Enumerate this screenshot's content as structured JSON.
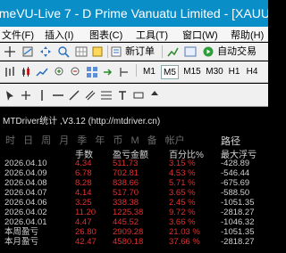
{
  "window": {
    "title": "rimeVU-Live 7 - D Prime Vanuatu Limited - [XAUU..."
  },
  "menu": [
    "文件(F)",
    "插入(I)",
    "图表(C)",
    "工具(T)",
    "窗口(W)",
    "帮助(H)"
  ],
  "toolbar": {
    "new_order": "新订单",
    "auto_trading": "自动交易"
  },
  "timeframes": [
    "M1",
    "M5",
    "M15",
    "M30",
    "H1",
    "H4"
  ],
  "selected_timeframe": "M5",
  "ea": {
    "title": "MTDriver统计 ,V3.12 (http://mtdriver.cn)",
    "period_tabs": [
      "时",
      "日",
      "周",
      "月",
      "季",
      "年",
      "币",
      "M",
      "备",
      "帐户"
    ],
    "path_label": "路径",
    "columns": [
      "手数",
      "盈亏金额",
      "百分比%",
      "最大浮亏"
    ],
    "rows": [
      {
        "date": "2026.04.10",
        "lots": "4.34",
        "pnl": "511.73",
        "pct": "3.15 %",
        "max_dd": "-428.89"
      },
      {
        "date": "2026.04.09",
        "lots": "6.78",
        "pnl": "702.81",
        "pct": "4.53 %",
        "max_dd": "-546.44"
      },
      {
        "date": "2026.04.08",
        "lots": "8.28",
        "pnl": "838.66",
        "pct": "5.71 %",
        "max_dd": "-675.69"
      },
      {
        "date": "2026.04.07",
        "lots": "4.14",
        "pnl": "517.70",
        "pct": "3.65 %",
        "max_dd": "-588.50"
      },
      {
        "date": "2026.04.06",
        "lots": "3.25",
        "pnl": "338.38",
        "pct": "2.45 %",
        "max_dd": "-1051.35"
      },
      {
        "date": "2026.04.02",
        "lots": "11.20",
        "pnl": "1225.38",
        "pct": "9.72 %",
        "max_dd": "-2818.27"
      },
      {
        "date": "2026.04.01",
        "lots": "4.47",
        "pnl": "445.52",
        "pct": "3.66 %",
        "max_dd": "-1046.32"
      },
      {
        "date": "本周盈亏",
        "lots": "26.80",
        "pnl": "2909.28",
        "pct": "21.03 %",
        "max_dd": "-1051.35"
      },
      {
        "date": "本月盈亏",
        "lots": "42.47",
        "pnl": "4580.18",
        "pct": "37.66 %",
        "max_dd": "-2818.27"
      }
    ]
  }
}
